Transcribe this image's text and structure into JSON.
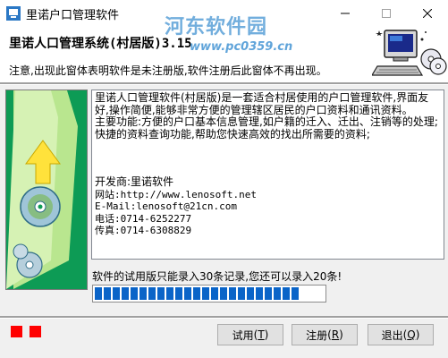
{
  "window": {
    "title": "里诺户口管理软件",
    "controls": {
      "minimize": "minimize-icon",
      "maximize": "maximize-icon",
      "close": "close-icon"
    }
  },
  "watermark": {
    "line1": "河东软件园",
    "line2": "www.pc0359.cn"
  },
  "header": {
    "heading": "里诺人口管理系统(村居版)3.15",
    "notice": "注意,出现此窗体表明软件是未注册版,软件注册后此窗体不再出现。"
  },
  "info": {
    "intro": "里诺人口管理软件(村居版)是一套适合村居使用的户口管理软件,界面友好,操作简便,能够非常方便的管理辖区居民的户口资料和通讯资料。",
    "features": "主要功能:方便的户口基本信息管理,如户籍的迁入、迁出、注销等的处理;快捷的资料查询功能,帮助您快速高效的找出所需要的资料;",
    "developer": "开发商:里诺软件",
    "website": "网站:http://www.lenosoft.net",
    "email": "E-Mail:lenosoft@21cn.com",
    "phone": "电话:0714-6252277",
    "fax": "传真:0714-6308829"
  },
  "trial_message": "软件的试用版只能录入30条记录,您还可以录入20条!",
  "progress": {
    "segments": 23
  },
  "buttons": {
    "trial": {
      "label": "试用",
      "key": "T"
    },
    "register": {
      "label": "注册",
      "key": "R"
    },
    "exit": {
      "label": "退出",
      "key": "Q"
    }
  },
  "colors": {
    "banner_green": "#0d9b55",
    "progress_blue": "#0a64c8",
    "status_red": "#ff0000"
  }
}
